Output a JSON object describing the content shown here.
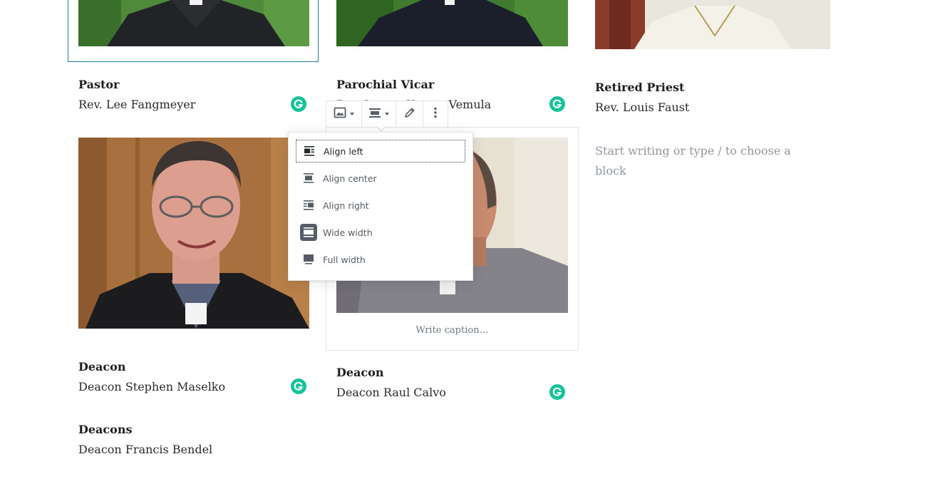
{
  "columns": [
    {
      "role": "Pastor",
      "name": "Rev. Lee Fangmeyer"
    },
    {
      "role": "Parochial Vicar",
      "name": "Rev. Jeevan Kumar Vemula"
    },
    {
      "role": "Retired Priest",
      "name": "Rev. Louis Faust"
    }
  ],
  "row2": [
    {
      "role": "Deacon",
      "name": "Deacon Stephen Maselko"
    },
    {
      "role": "Deacon",
      "name": "Deacon Raul Calvo"
    }
  ],
  "row3": {
    "role": "Deacons",
    "name": "Deacon Francis Bendel"
  },
  "image_block": {
    "caption_placeholder": "Write caption…"
  },
  "paragraph_placeholder": "Start writing or type / to choose a block",
  "toolbar": {
    "buttons": [
      {
        "icon": "image-icon"
      },
      {
        "icon": "align-icon"
      },
      {
        "icon": "pencil-icon"
      },
      {
        "icon": "more-vertical-icon"
      }
    ]
  },
  "align_menu": {
    "items": [
      {
        "label": "Align left",
        "icon": "align-left-icon",
        "focused": true
      },
      {
        "label": "Align center",
        "icon": "align-center-icon"
      },
      {
        "label": "Align right",
        "icon": "align-right-icon"
      },
      {
        "label": "Wide width",
        "icon": "align-wide-icon",
        "active": true
      },
      {
        "label": "Full width",
        "icon": "align-full-width-icon"
      }
    ]
  },
  "colors": {
    "grammarly": "#15c39a",
    "selected_border": "#1f7ea1",
    "menu_text": "#555d66"
  }
}
